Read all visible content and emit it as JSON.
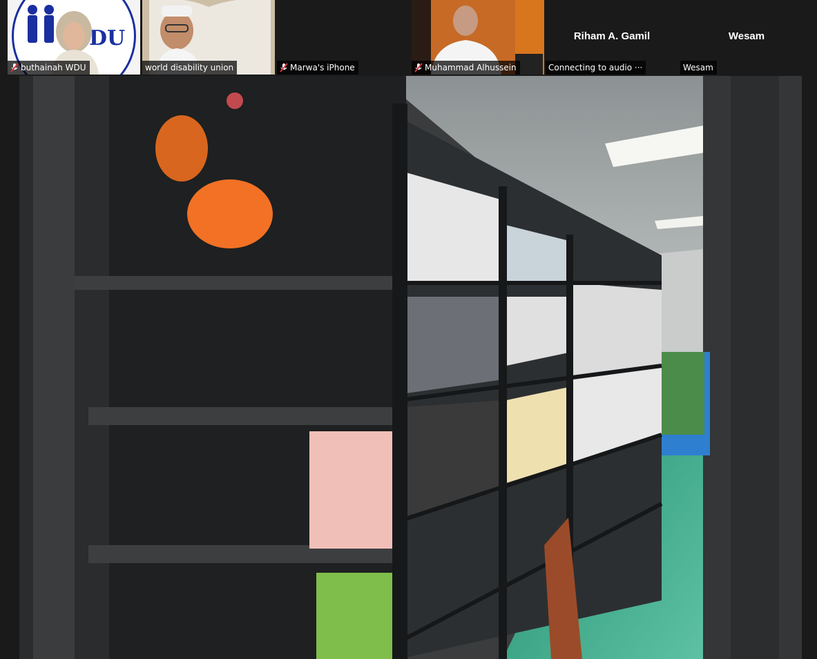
{
  "participants": [
    {
      "name": "buthainah WDU",
      "muted": true
    },
    {
      "name": "world disability union",
      "muted": false
    },
    {
      "name": "Marwa's iPhone",
      "muted": true
    },
    {
      "name": "Muhammad Alhussein",
      "muted": true
    },
    {
      "display_name": "Riham A. Gamil",
      "status": "Connecting to audio ···"
    },
    {
      "display_name": "Wesam",
      "name": "Wesam"
    }
  ],
  "logo": {
    "text": "DU",
    "ring_color": "#1a2fa0"
  },
  "colors": {
    "muted_icon": "#d9363e",
    "label_bg": "rgba(0,0,0,0.72)"
  },
  "main_video": {
    "description_icon": "video-feed"
  }
}
